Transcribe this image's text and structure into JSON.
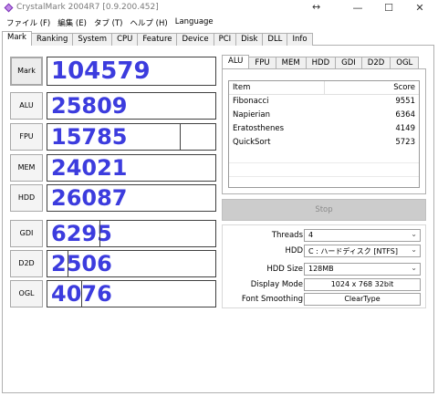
{
  "window": {
    "title": "CrystalMark 2004R7 [0.9.200.452]",
    "resize_glyph": "↔",
    "minimize_glyph": "—",
    "maximize_glyph": "☐",
    "close_glyph": "✕"
  },
  "menu": {
    "items": [
      "ファイル (F)",
      "編集 (E)",
      "タブ (T)",
      "ヘルプ (H)",
      "Language"
    ]
  },
  "tabs": [
    "Mark",
    "Ranking",
    "System",
    "CPU",
    "Feature",
    "Device",
    "PCI",
    "Disk",
    "DLL",
    "Info"
  ],
  "scores": [
    {
      "label": "Mark",
      "value": "104579"
    },
    {
      "label": "ALU",
      "value": "25809"
    },
    {
      "label": "FPU",
      "value": "15785"
    },
    {
      "label": "MEM",
      "value": "24021"
    },
    {
      "label": "HDD",
      "value": "26087"
    },
    {
      "label": "GDI",
      "value": "6295"
    },
    {
      "label": "D2D",
      "value": "2506"
    },
    {
      "label": "OGL",
      "value": "4076"
    }
  ],
  "subtabs": [
    "ALU",
    "FPU",
    "MEM",
    "HDD",
    "GDI",
    "D2D",
    "OGL"
  ],
  "alu_table": {
    "headers": [
      "Item",
      "Score"
    ],
    "rows": [
      [
        "Fibonacci",
        "9551"
      ],
      [
        "Napierian",
        "6364"
      ],
      [
        "Eratosthenes",
        "4149"
      ],
      [
        "QuickSort",
        "5723"
      ]
    ]
  },
  "stop_label": "Stop",
  "settings": {
    "threads_label": "Threads",
    "threads_value": "4",
    "hdd_label": "HDD",
    "hdd_value": "C : ハードディスク [NTFS]",
    "hdd_size_label": "HDD Size",
    "hdd_size_value": "128MB",
    "display_mode_label": "Display Mode",
    "display_mode_value": "1024 x 768 32bit",
    "font_smoothing_label": "Font Smoothing",
    "font_smoothing_value": "ClearType",
    "dropdown_glyph": "⌄"
  },
  "colors": {
    "score_text": "#3c3cde",
    "stop_bg": "#cccccc"
  }
}
